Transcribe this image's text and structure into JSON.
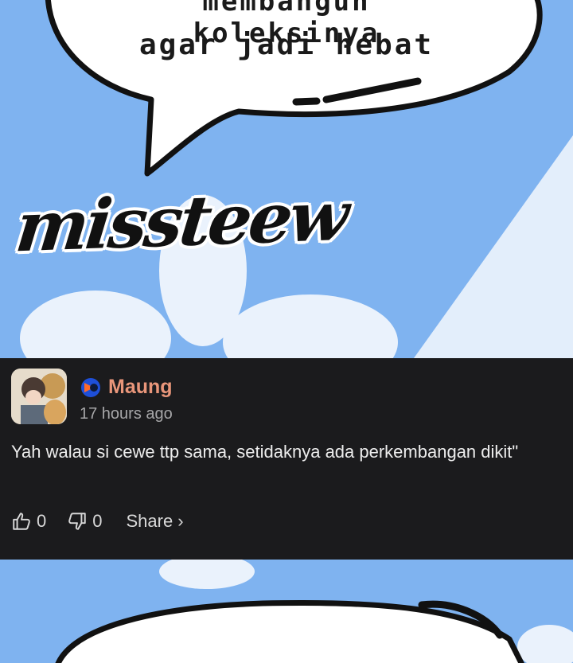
{
  "comic": {
    "bubble_line1": "membangun koleksinya",
    "bubble_line2": "agar jadi hebat",
    "watermark": "missteew"
  },
  "comment": {
    "username": "Maung",
    "timestamp": "17 hours ago",
    "text": "Yah walau si cewe ttp sama, setidaknya ada perkembangan dikit\"",
    "likes": "0",
    "dislikes": "0",
    "share_label": "Share",
    "share_chevron": "›",
    "username_color": "#e9967a",
    "background_color": "#1b1b1d"
  },
  "icons": {
    "like": "thumbs-up-icon",
    "dislike": "thumbs-down-icon",
    "badge": "user-badge-icon",
    "share": "chevron-right-icon"
  }
}
